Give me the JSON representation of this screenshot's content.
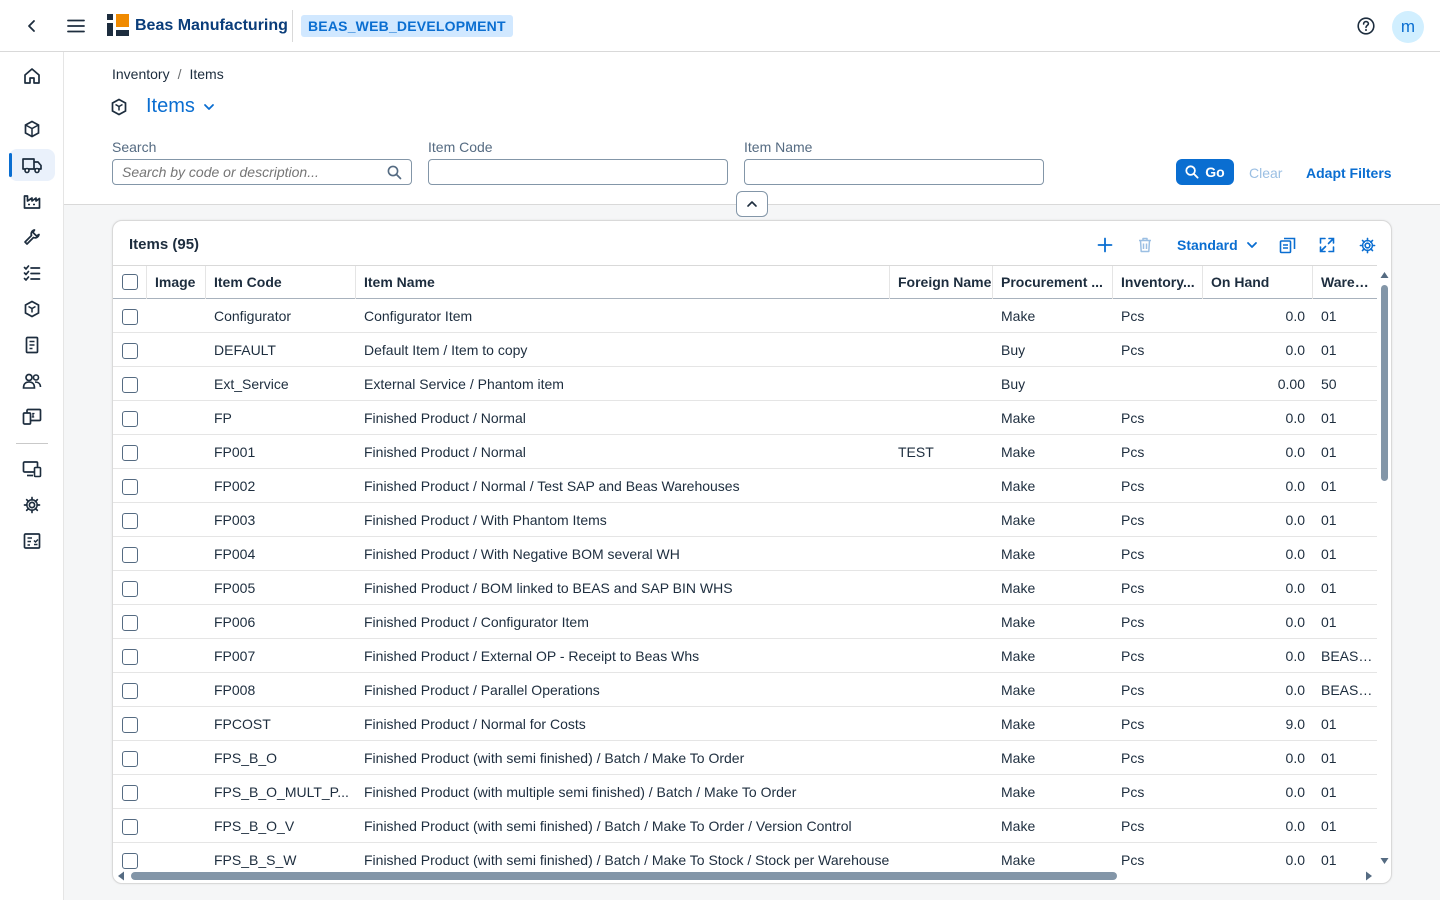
{
  "shell": {
    "brand": "Beas Manufacturing",
    "environment": "BEAS_WEB_DEVELOPMENT",
    "avatar_initial": "m"
  },
  "sidebar": {
    "items": [
      {
        "icon": "home-icon"
      },
      {
        "icon": "components-icon"
      },
      {
        "icon": "delivery-truck-icon",
        "active": true
      },
      {
        "icon": "factory-icon"
      },
      {
        "icon": "wrench-icon"
      },
      {
        "icon": "checklist-icon"
      },
      {
        "icon": "product-icon"
      },
      {
        "icon": "document-icon"
      },
      {
        "icon": "group-icon"
      },
      {
        "icon": "monitor-payment-icon"
      },
      {
        "icon": "devices-icon"
      },
      {
        "icon": "settings-icon"
      },
      {
        "icon": "report-icon"
      }
    ]
  },
  "breadcrumb": {
    "items": [
      "Inventory",
      "Items"
    ],
    "separator": "/"
  },
  "page": {
    "title": "Items"
  },
  "filters": {
    "search_label": "Search",
    "search_placeholder": "Search by code or description...",
    "item_code_label": "Item Code",
    "item_code_value": "",
    "item_name_label": "Item Name",
    "item_name_value": "",
    "go_label": "Go",
    "clear_label": "Clear",
    "adapt_label": "Adapt Filters"
  },
  "table": {
    "title": "Items (95)",
    "variant": "Standard",
    "columns": [
      "Image",
      "Item Code",
      "Item Name",
      "Foreign Name",
      "Procurement ...",
      "Inventory...",
      "On Hand",
      "Warehou"
    ],
    "rows": [
      {
        "code": "Configurator",
        "name": "Configurator Item",
        "foreign": "",
        "proc": "Make",
        "uom": "Pcs",
        "onhand": "0.0",
        "wh": "01"
      },
      {
        "code": "DEFAULT",
        "name": "Default Item / Item to copy",
        "foreign": "",
        "proc": "Buy",
        "uom": "Pcs",
        "onhand": "0.0",
        "wh": "01"
      },
      {
        "code": "Ext_Service",
        "name": "External Service / Phantom item",
        "foreign": "",
        "proc": "Buy",
        "uom": "",
        "onhand": "0.00",
        "wh": "50"
      },
      {
        "code": "FP",
        "name": "Finished Product / Normal",
        "foreign": "",
        "proc": "Make",
        "uom": "Pcs",
        "onhand": "0.0",
        "wh": "01"
      },
      {
        "code": "FP001",
        "name": "Finished Product / Normal",
        "foreign": "TEST",
        "proc": "Make",
        "uom": "Pcs",
        "onhand": "0.0",
        "wh": "01"
      },
      {
        "code": "FP002",
        "name": "Finished Product / Normal / Test SAP and Beas Warehouses",
        "foreign": "",
        "proc": "Make",
        "uom": "Pcs",
        "onhand": "0.0",
        "wh": "01"
      },
      {
        "code": "FP003",
        "name": "Finished Product / With Phantom Items",
        "foreign": "",
        "proc": "Make",
        "uom": "Pcs",
        "onhand": "0.0",
        "wh": "01"
      },
      {
        "code": "FP004",
        "name": "Finished Product / With Negative BOM several WH",
        "foreign": "",
        "proc": "Make",
        "uom": "Pcs",
        "onhand": "0.0",
        "wh": "01"
      },
      {
        "code": "FP005",
        "name": "Finished Product / BOM linked to BEAS and SAP BIN WHS",
        "foreign": "",
        "proc": "Make",
        "uom": "Pcs",
        "onhand": "0.0",
        "wh": "01"
      },
      {
        "code": "FP006",
        "name": "Finished Product / Configurator Item",
        "foreign": "",
        "proc": "Make",
        "uom": "Pcs",
        "onhand": "0.0",
        "wh": "01"
      },
      {
        "code": "FP007",
        "name": "Finished Product / External OP - Receipt to Beas Whs",
        "foreign": "",
        "proc": "Make",
        "uom": "Pcs",
        "onhand": "0.0",
        "wh": "BEAS_BI"
      },
      {
        "code": "FP008",
        "name": "Finished Product / Parallel Operations",
        "foreign": "",
        "proc": "Make",
        "uom": "Pcs",
        "onhand": "0.0",
        "wh": "BEAS_BI"
      },
      {
        "code": "FPCOST",
        "name": "Finished Product / Normal for Costs",
        "foreign": "",
        "proc": "Make",
        "uom": "Pcs",
        "onhand": "9.0",
        "wh": "01"
      },
      {
        "code": "FPS_B_O",
        "name": "Finished Product (with semi finished) / Batch / Make To Order",
        "foreign": "",
        "proc": "Make",
        "uom": "Pcs",
        "onhand": "0.0",
        "wh": "01"
      },
      {
        "code": "FPS_B_O_MULT_P...",
        "name": "Finished Product (with multiple semi finished) / Batch / Make To Order",
        "foreign": "",
        "proc": "Make",
        "uom": "Pcs",
        "onhand": "0.0",
        "wh": "01"
      },
      {
        "code": "FPS_B_O_V",
        "name": "Finished Product (with semi finished) / Batch / Make To Order / Version Control",
        "foreign": "",
        "proc": "Make",
        "uom": "Pcs",
        "onhand": "0.0",
        "wh": "01"
      },
      {
        "code": "FPS_B_S_W",
        "name": "Finished Product (with semi finished) / Batch / Make To Stock / Stock per Warehouse",
        "foreign": "",
        "proc": "Make",
        "uom": "Pcs",
        "onhand": "0.0",
        "wh": "01"
      }
    ]
  },
  "colors": {
    "accent": "#0a6ed1",
    "brand_text": "#0a3d7a",
    "env_badge_bg": "#d1e8ff"
  }
}
